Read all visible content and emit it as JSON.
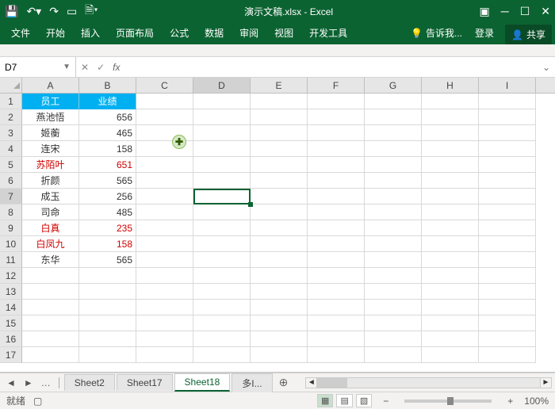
{
  "titlebar": {
    "title": "演示文稿.xlsx - Excel"
  },
  "ribbon": {
    "tabs": [
      "文件",
      "开始",
      "插入",
      "页面布局",
      "公式",
      "数据",
      "审阅",
      "视图",
      "开发工具"
    ],
    "tell_label": "告诉我...",
    "signin": "登录",
    "share": "共享"
  },
  "namebox": {
    "ref": "D7"
  },
  "columns": [
    "A",
    "B",
    "C",
    "D",
    "E",
    "F",
    "G",
    "H",
    "I"
  ],
  "header_row": {
    "emp": "员工",
    "perf": "业绩"
  },
  "rows": [
    {
      "name": "燕池悟",
      "val": "656",
      "red": false
    },
    {
      "name": "姬蘅",
      "val": "465",
      "red": false
    },
    {
      "name": "连宋",
      "val": "158",
      "red": false
    },
    {
      "name": "苏陌叶",
      "val": "651",
      "red": true
    },
    {
      "name": "折颜",
      "val": "565",
      "red": false
    },
    {
      "name": "成玉",
      "val": "256",
      "red": false
    },
    {
      "name": "司命",
      "val": "485",
      "red": false
    },
    {
      "name": "白真",
      "val": "235",
      "red": true
    },
    {
      "name": "白凤九",
      "val": "158",
      "red": true
    },
    {
      "name": "东华",
      "val": "565",
      "red": false
    }
  ],
  "sheets": {
    "tabs": [
      "Sheet2",
      "Sheet17",
      "Sheet18",
      "多I..."
    ],
    "active": 2
  },
  "status": {
    "ready": "就绪",
    "zoom": "100%"
  }
}
